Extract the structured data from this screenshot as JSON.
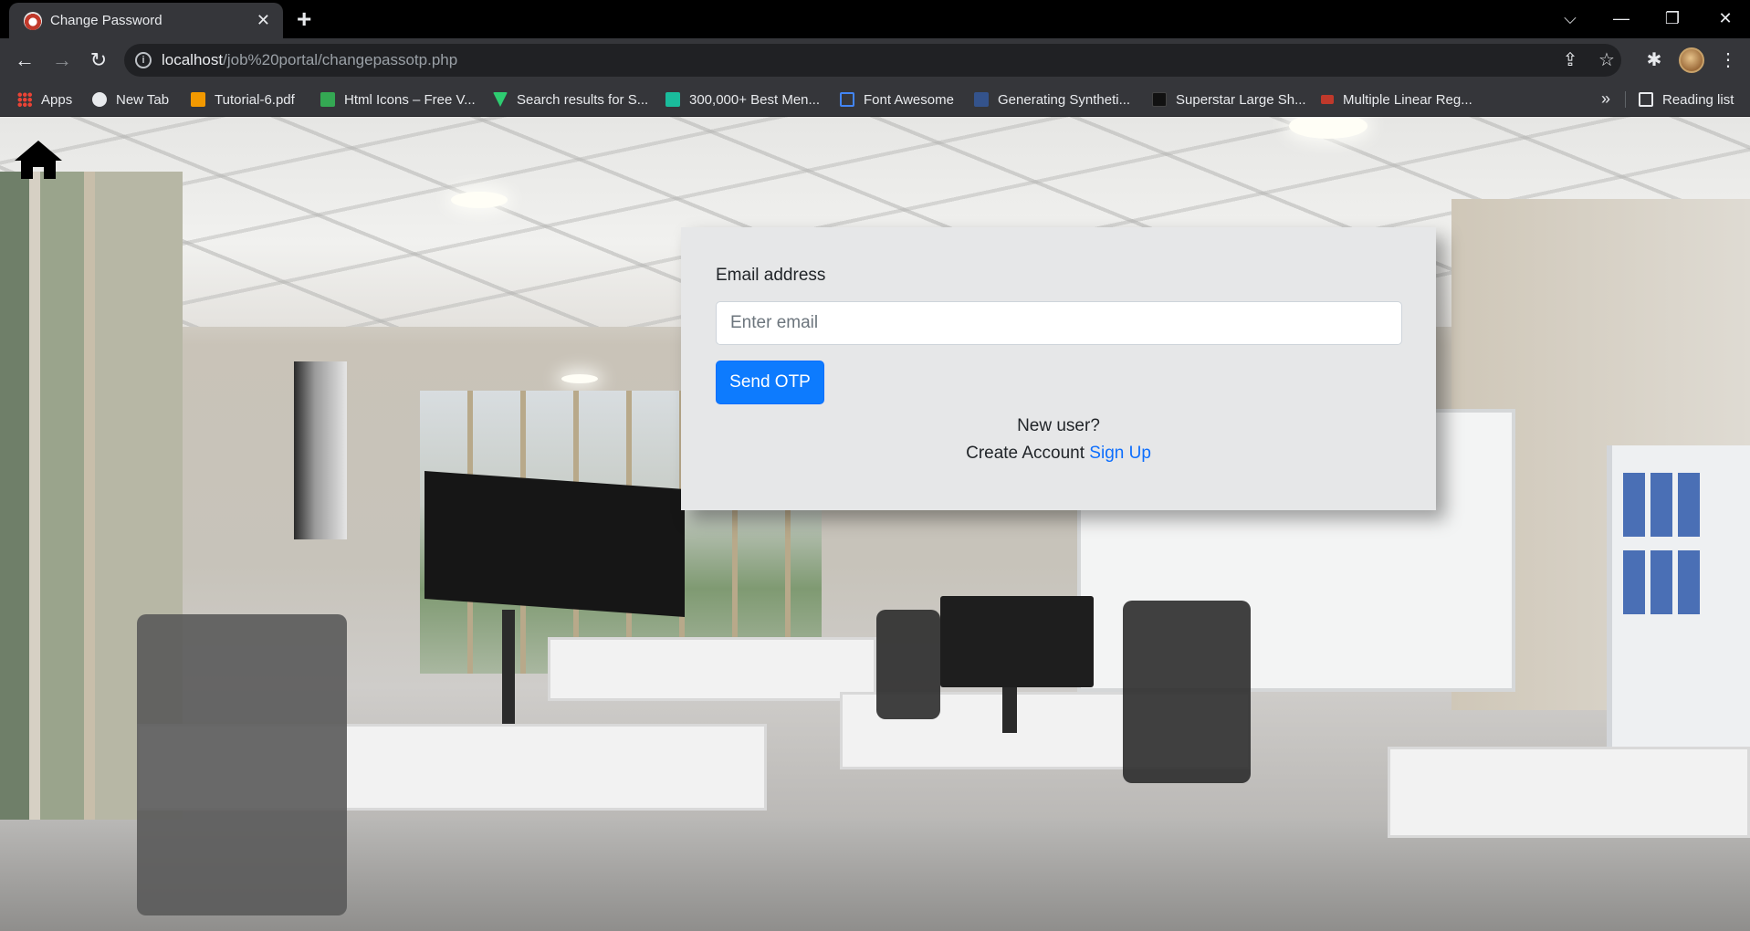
{
  "browser": {
    "tab": {
      "title": "Change Password",
      "close": "✕"
    },
    "new_tab": "+",
    "window_controls": {
      "tab_search": "⌵",
      "minimize": "—",
      "restore": "❐",
      "close": "✕"
    },
    "nav": {
      "back": "←",
      "forward": "→",
      "reload": "↻"
    },
    "address": {
      "host": "localhost",
      "path": "/job%20portal/changepassotp.php",
      "info_icon": "i"
    },
    "omnibox_icons": {
      "share": "⇪",
      "star": "☆"
    },
    "toolbar_icons": {
      "extensions": "✱",
      "menu": "⋮"
    },
    "bookmarks": [
      {
        "label": "Apps",
        "color": "#ea4335"
      },
      {
        "label": "New Tab",
        "color": "#e8eaed"
      },
      {
        "label": "Tutorial-6.pdf",
        "color": "#f29900"
      },
      {
        "label": "Html Icons – Free V...",
        "color": "#34a853"
      },
      {
        "label": "Search results for S...",
        "color": "#2ecc71"
      },
      {
        "label": "300,000+ Best Men...",
        "color": "#1abc9c"
      },
      {
        "label": "Font Awesome",
        "color": "#4285f4"
      },
      {
        "label": "Generating Syntheti...",
        "color": "#34538c"
      },
      {
        "label": "Superstar Large Sh...",
        "color": "#111111"
      },
      {
        "label": "Multiple Linear Reg...",
        "color": "#c0392b"
      }
    ],
    "bookmarks_more": "»",
    "reading_list": "Reading list"
  },
  "page": {
    "form": {
      "email_label": "Email address",
      "email_placeholder": "Enter email",
      "email_value": "",
      "submit_label": "Send OTP",
      "new_user_text": "New user?",
      "create_account_text": "Create Account",
      "signup_link": "Sign Up"
    },
    "colors": {
      "primary": "#0d7bfe",
      "link": "#0d6efd",
      "card_bg": "#e6e7e8"
    }
  }
}
